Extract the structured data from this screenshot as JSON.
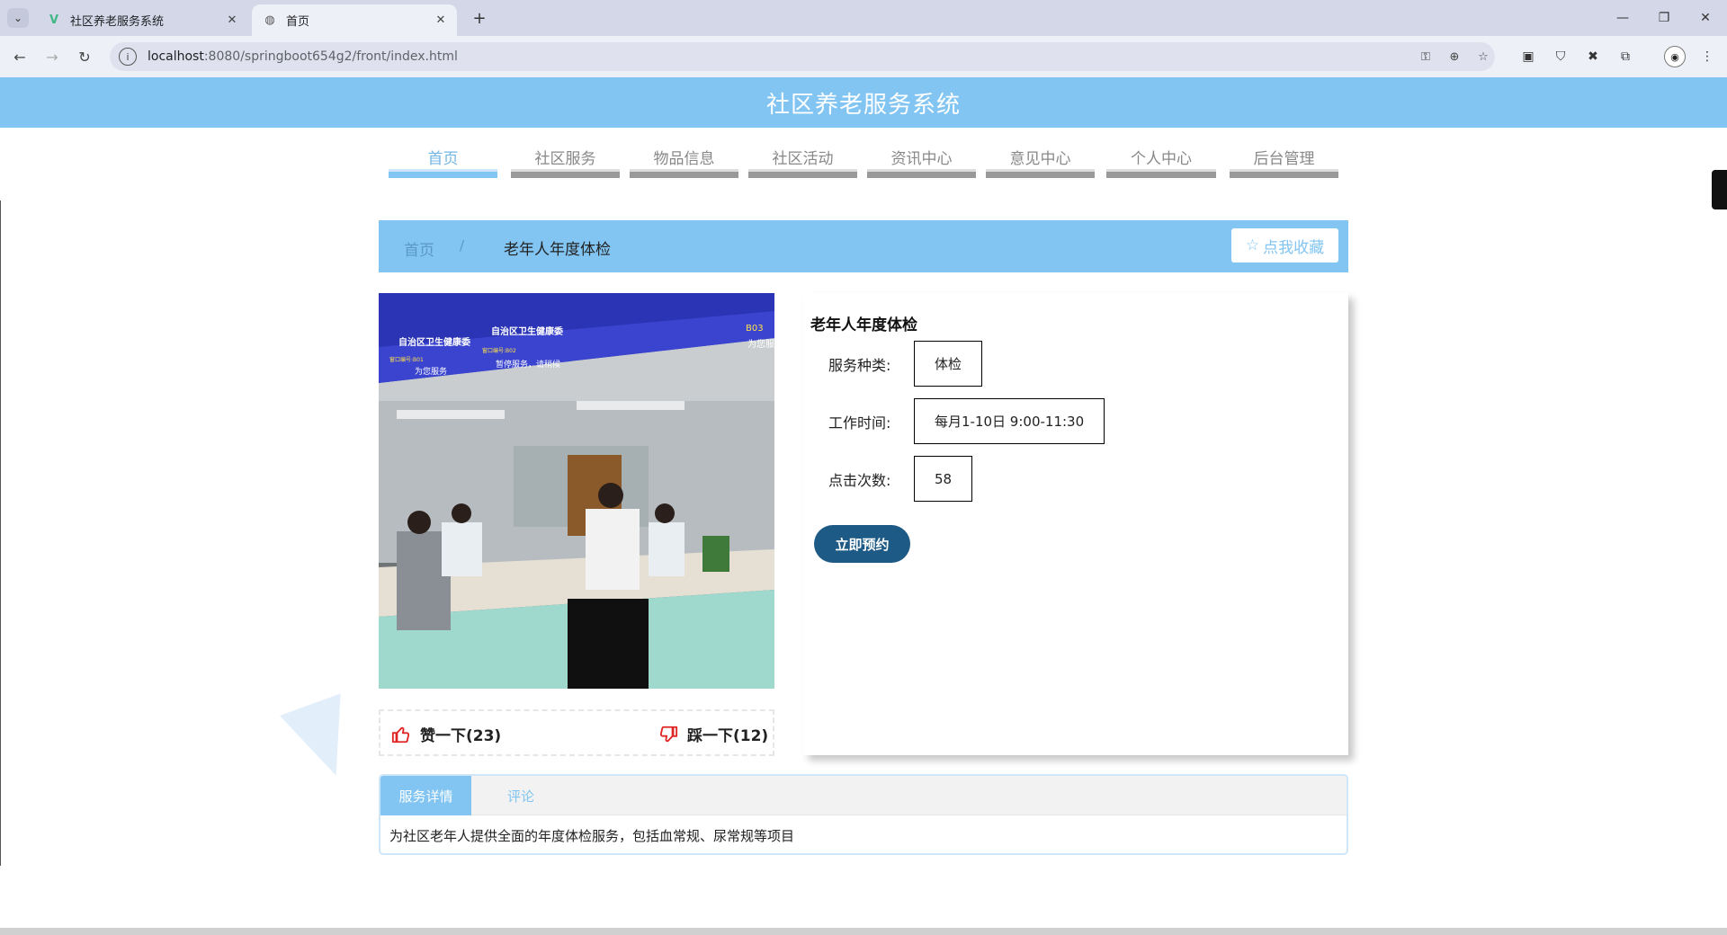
{
  "browser": {
    "tabs": [
      {
        "title": "社区养老服务系统",
        "active": false,
        "favicon": "vue-icon"
      },
      {
        "title": "首页",
        "active": true,
        "favicon": "globe-icon"
      }
    ],
    "url_host": "localhost",
    "url_rest": ":8080/springboot654g2/front/index.html"
  },
  "site": {
    "title": "社区养老服务系统"
  },
  "nav": {
    "items": [
      {
        "label": "首页",
        "active": true
      },
      {
        "label": "社区服务",
        "active": false
      },
      {
        "label": "物品信息",
        "active": false
      },
      {
        "label": "社区活动",
        "active": false
      },
      {
        "label": "资讯中心",
        "active": false
      },
      {
        "label": "意见中心",
        "active": false
      },
      {
        "label": "个人中心",
        "active": false
      },
      {
        "label": "后台管理",
        "active": false
      }
    ]
  },
  "breadcrumb": {
    "home": "首页",
    "separator": "/",
    "current": "老年人年度体检",
    "favorite_label": "点我收藏"
  },
  "service": {
    "title": "老年人年度体检",
    "fields": [
      {
        "label": "服务种类:",
        "value": "体检"
      },
      {
        "label": "工作时间:",
        "value": "每月1-10日 9:00-11:30"
      },
      {
        "label": "点击次数:",
        "value": "58"
      }
    ],
    "book_label": "立即预约"
  },
  "votes": {
    "up_label": "赞一下(23)",
    "down_label": "踩一下(12)"
  },
  "photo_signs": {
    "sign_1": "自治区卫生健康委",
    "sign_2": "自治区卫生健康委",
    "window_1": "窗口编号:B01",
    "window_2": "窗口编号:B02",
    "window_3": "B03",
    "msg_1": "为您服务",
    "msg_2": "暂停服务，请稍候",
    "msg_3": "为您服"
  },
  "detail_tabs": {
    "tabs": [
      {
        "label": "服务详情",
        "active": true
      },
      {
        "label": "评论",
        "active": false
      }
    ],
    "content": "为社区老年人提供全面的年度体检服务，包括血常规、尿常规等项目"
  },
  "colors": {
    "header_blue": "#82c5f2",
    "book_button": "#1e5a86",
    "nav_inactive": "#999999"
  }
}
